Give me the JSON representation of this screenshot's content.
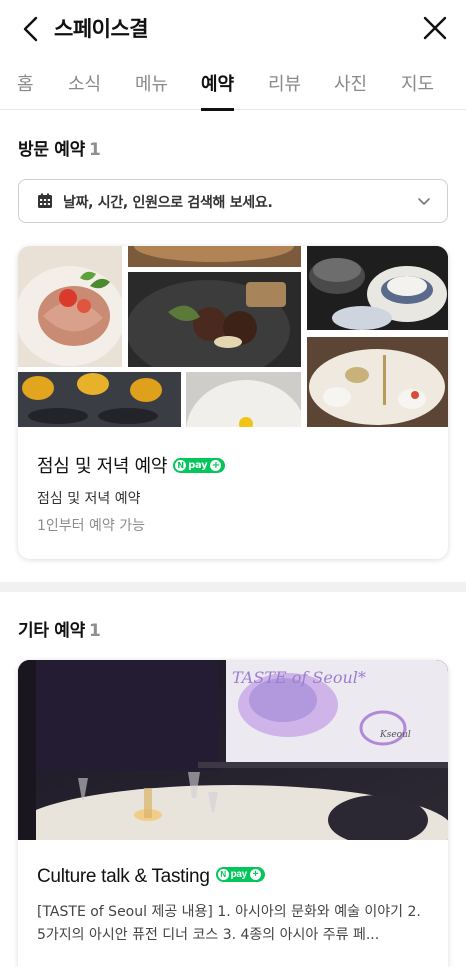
{
  "header": {
    "title": "스페이스결",
    "back_icon": "chevron-left-icon",
    "close_icon": "close-icon"
  },
  "tabs": [
    {
      "label": "홈",
      "active": false
    },
    {
      "label": "소식",
      "active": false
    },
    {
      "label": "메뉴",
      "active": false
    },
    {
      "label": "예약",
      "active": true
    },
    {
      "label": "리뷰",
      "active": false
    },
    {
      "label": "사진",
      "active": false
    },
    {
      "label": "지도",
      "active": false
    }
  ],
  "visit_section": {
    "title": "방문 예약",
    "count": "1"
  },
  "date_search": {
    "label": "날짜, 시간, 인원으로 검색해 보세요.",
    "icon": "calendar-icon",
    "chevron_icon": "chevron-down-icon"
  },
  "card1": {
    "title": "점심 및 저녁 예약",
    "badge": "pay",
    "subtitle": "점심 및 저녁 예약",
    "note": "1인부터 예약 가능"
  },
  "other_section": {
    "title": "기타 예약",
    "count": "1"
  },
  "card2": {
    "title": "Culture talk & Tasting",
    "badge": "pay",
    "description": "[TASTE of Seoul 제공 내용] 1. 아시아의 문화와 예술 이야기 2. 5가지의 아시안 퓨전 디너 코스 3. 4종의 아시아 주류 페...",
    "screen_text": "TASTE of Seoul*",
    "screen_logo": "Kseoul"
  },
  "colors": {
    "npay_green": "#03c75a",
    "active_tab": "#111111",
    "inactive_tab": "#8a8a8a",
    "divider": "#f1f1f1"
  }
}
